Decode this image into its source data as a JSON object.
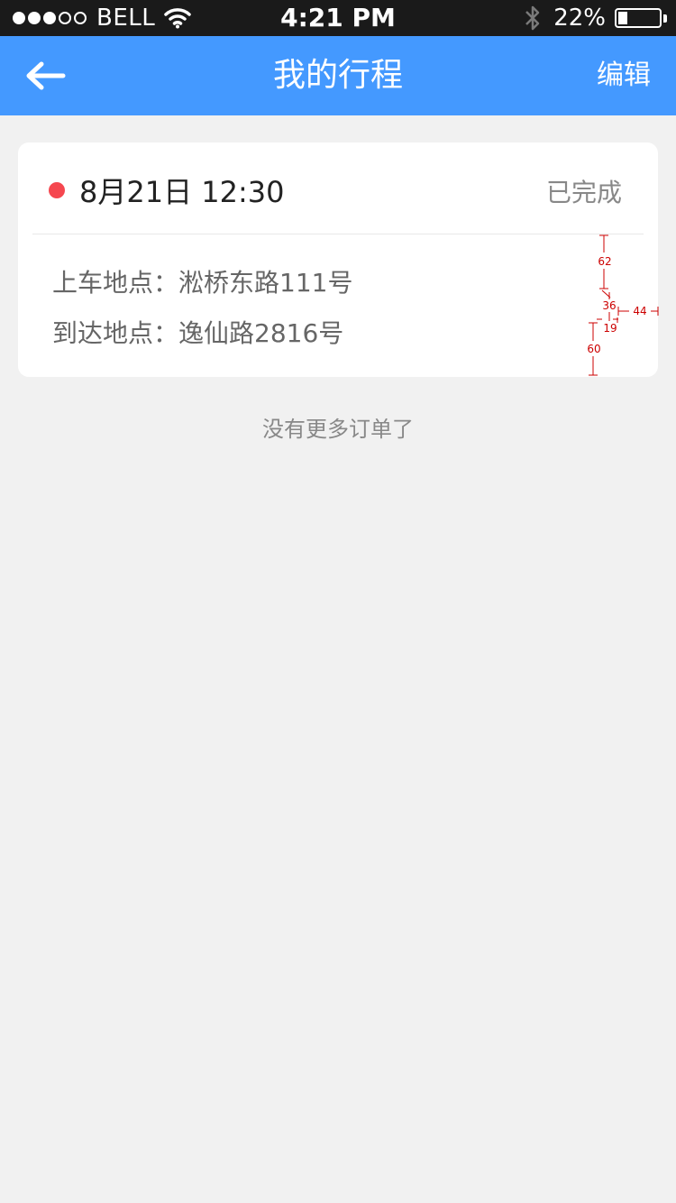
{
  "status_bar": {
    "carrier": "BELL",
    "time": "4:21 PM",
    "battery_percent": "22%",
    "battery_level": 0.22,
    "signal_bars_filled": 3,
    "signal_bars_total": 5
  },
  "nav": {
    "title": "我的行程",
    "edit_label": "编辑",
    "back_icon": "arrow-left-icon"
  },
  "trip": {
    "datetime": "8月21日 12:30",
    "status": "已完成",
    "status_dot_color": "#f5474f",
    "pickup": "上车地点：淞桥东路111号",
    "dropoff": "到达地点：逸仙路2816号"
  },
  "annotations": {
    "a": "62",
    "b": "36",
    "c": "44",
    "d": "19",
    "e": "60"
  },
  "footer": {
    "no_more_text": "没有更多订单了"
  },
  "colors": {
    "nav_bg": "#4499ff",
    "page_bg": "#f1f1f1",
    "annotation": "#cc0000"
  }
}
